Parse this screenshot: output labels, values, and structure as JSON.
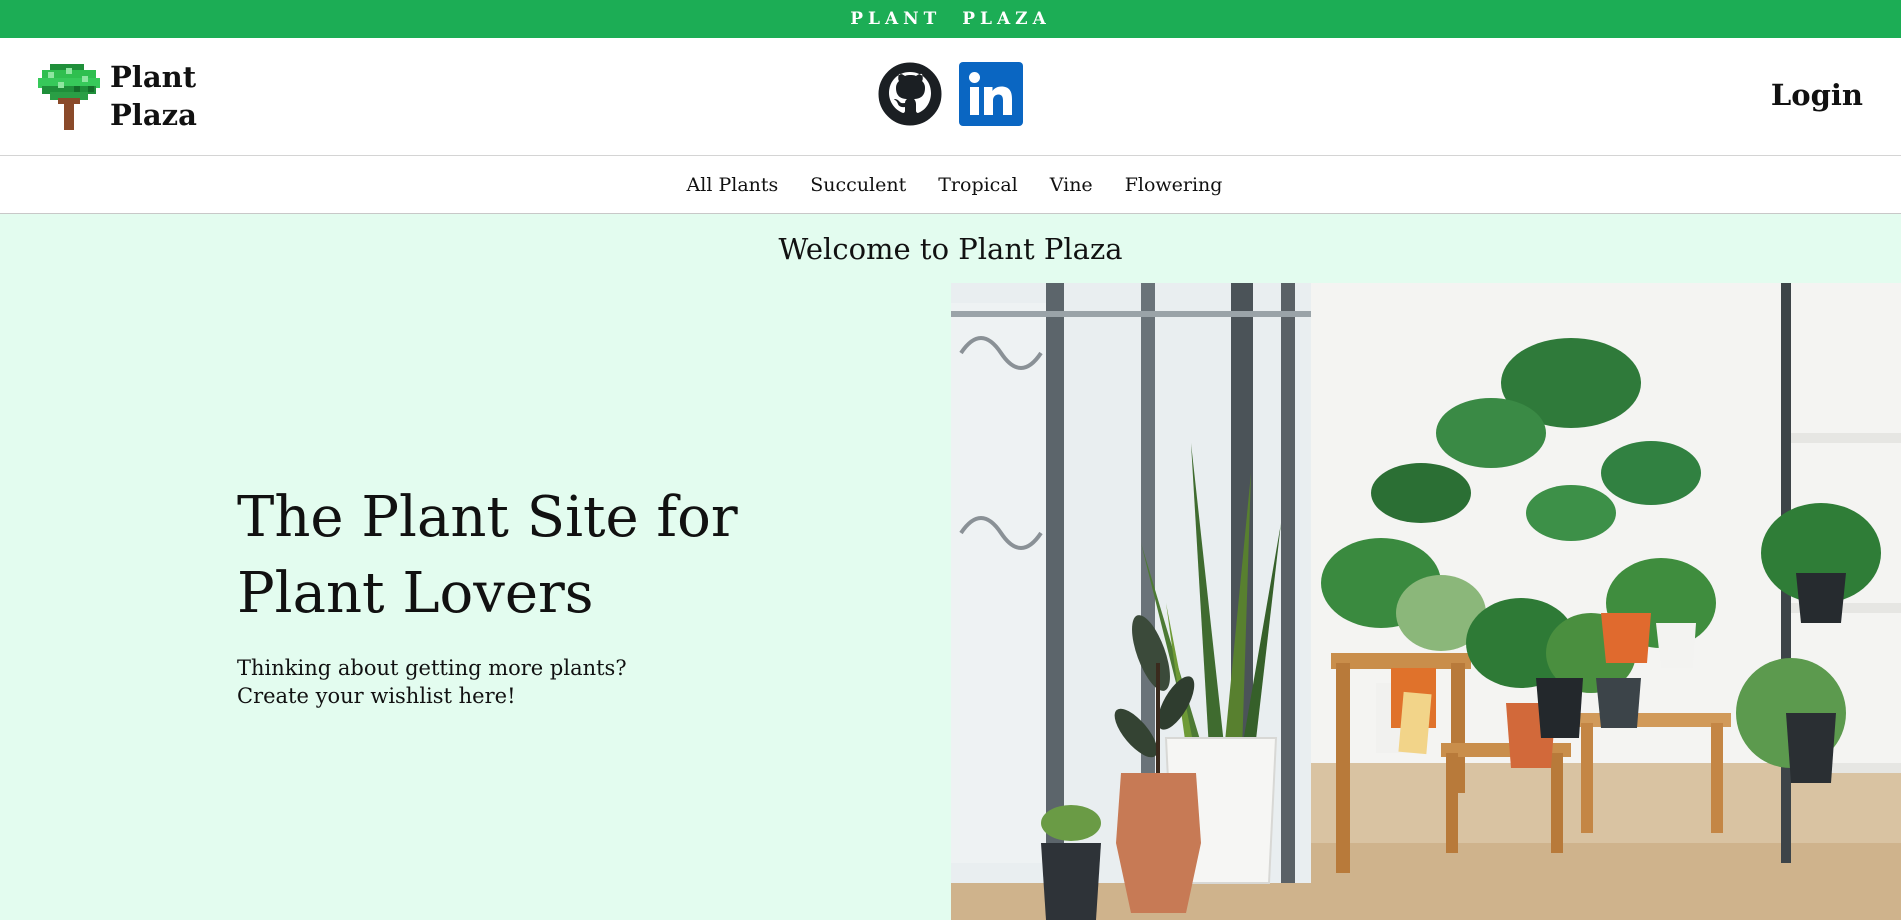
{
  "banner": {
    "title": "PLANT  PLAZA",
    "color": "#1cad55"
  },
  "header": {
    "brand_name": "Plant Plaza",
    "logo_icon": "pixel-tree-icon",
    "social": [
      {
        "name": "GitHub",
        "icon": "github-icon"
      },
      {
        "name": "LinkedIn",
        "icon": "linkedin-icon"
      }
    ],
    "login_label": "Login"
  },
  "nav": {
    "items": [
      {
        "label": "All Plants"
      },
      {
        "label": "Succulent"
      },
      {
        "label": "Tropical"
      },
      {
        "label": "Vine"
      },
      {
        "label": "Flowering"
      }
    ]
  },
  "hero": {
    "welcome": "Welcome to Plant Plaza",
    "title": "The Plant Site for Plant Lovers",
    "subtitle": "Thinking about getting more plants? Create your wishlist here!",
    "background_color": "#e3fcef"
  }
}
